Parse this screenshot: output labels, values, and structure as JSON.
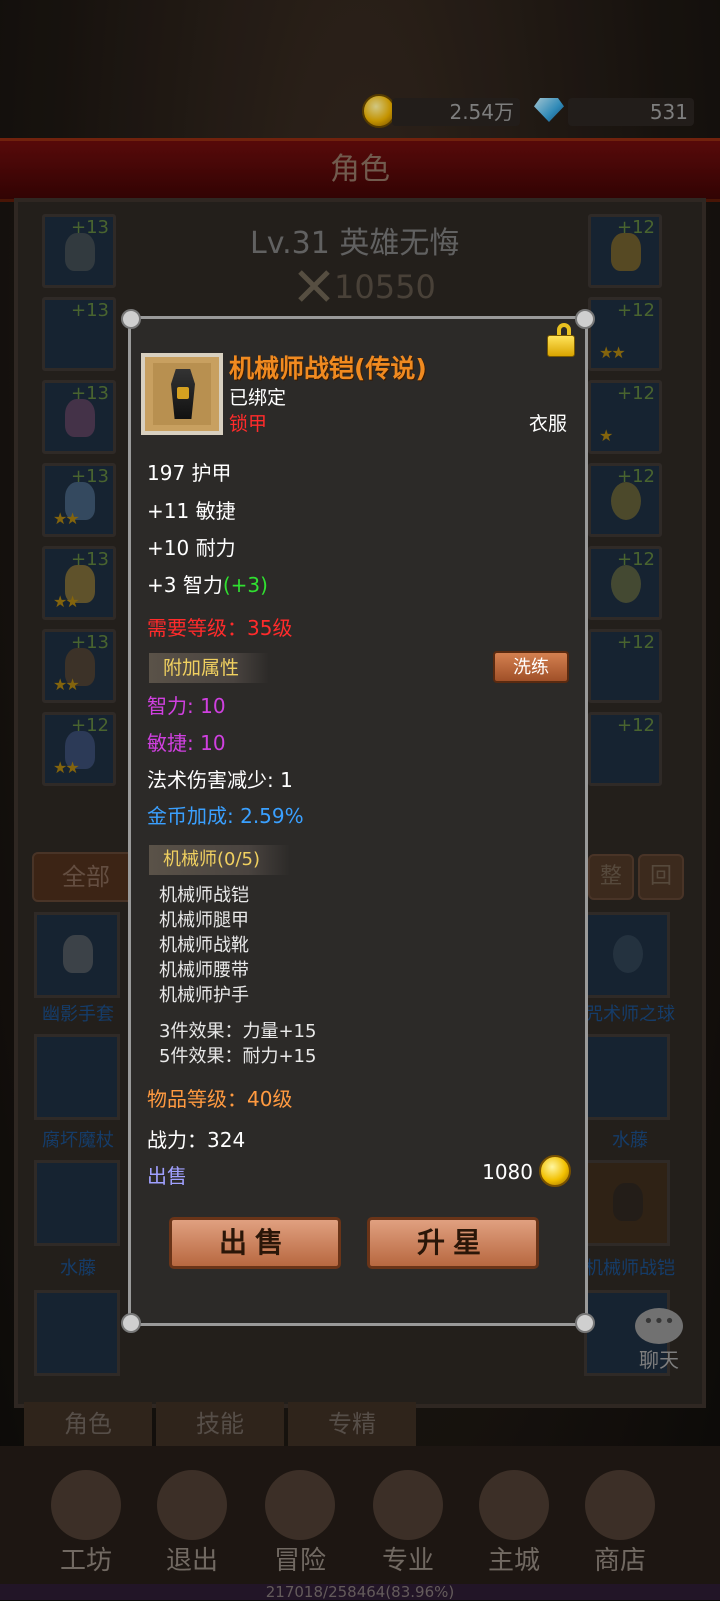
{
  "resources": {
    "gold": "2.54万",
    "gems": "531"
  },
  "screen_title": "角色",
  "hero": {
    "name": "Lv.31 英雄无悔",
    "power": "10550"
  },
  "left_slots": [
    "+13",
    "+13",
    "+13",
    "+13",
    "+13",
    "+13",
    "+12"
  ],
  "right_slots": [
    "+12",
    "+12",
    "+12",
    "+12",
    "+12",
    "+12",
    "+12"
  ],
  "bag": {
    "tab_all": "全部",
    "sort_button": "整",
    "recycle_button": "回",
    "row1": [
      "幽影手套",
      "",
      "",
      "",
      "",
      "咒术师之球"
    ],
    "row2": [
      "腐坏魔杖",
      "",
      "",
      "",
      "",
      "水藤"
    ],
    "row3": [
      "水藤",
      "",
      "",
      "",
      "",
      "机械师战铠"
    ]
  },
  "sub_tabs": [
    "角色",
    "技能",
    "专精"
  ],
  "bottom_nav": [
    "工坊",
    "退出",
    "冒险",
    "专业",
    "主城",
    "商店"
  ],
  "xp_text": "217018/258464(83.96%)",
  "chat_label": "聊天",
  "modal": {
    "title": "机械师战铠(传说)",
    "bound": "已绑定",
    "armor_type": "锁甲",
    "slot": "衣服",
    "stats": [
      {
        "text": "197 护甲"
      },
      {
        "text": "+11 敏捷"
      },
      {
        "text": "+10 耐力"
      },
      {
        "text": "+3 智力",
        "bonus": "(+3)"
      }
    ],
    "required_level": "需要等级：35级",
    "extra_attr_title": "附加属性",
    "refine_button": "洗练",
    "extra_attrs": {
      "int": "智力: 10",
      "agi": "敏捷: 10",
      "spell_dmg": "法术伤害减少: 1",
      "gold_bonus": "金币加成: 2.59%"
    },
    "set_title": "机械师(0/5)",
    "set_items": [
      "机械师战铠",
      "机械师腿甲",
      "机械师战靴",
      "机械师腰带",
      "机械师护手"
    ],
    "set_effects": [
      "3件效果：力量+15",
      "5件效果：耐力+15"
    ],
    "item_level": "物品等级：40级",
    "combat_power": "战力：324",
    "sell_label": "出售",
    "sell_price": "1080",
    "sell_button": "出售",
    "upgrade_button": "升星"
  }
}
